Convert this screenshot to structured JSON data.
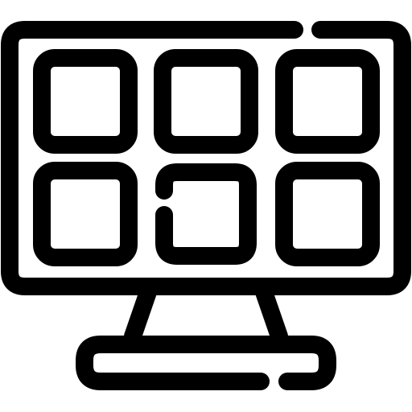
{
  "icon": {
    "name": "monitor-grid-icon",
    "stroke_color": "#000000",
    "background_color": "#ffffff",
    "grid": {
      "rows": 2,
      "columns": 3,
      "tile_count": 6
    }
  }
}
